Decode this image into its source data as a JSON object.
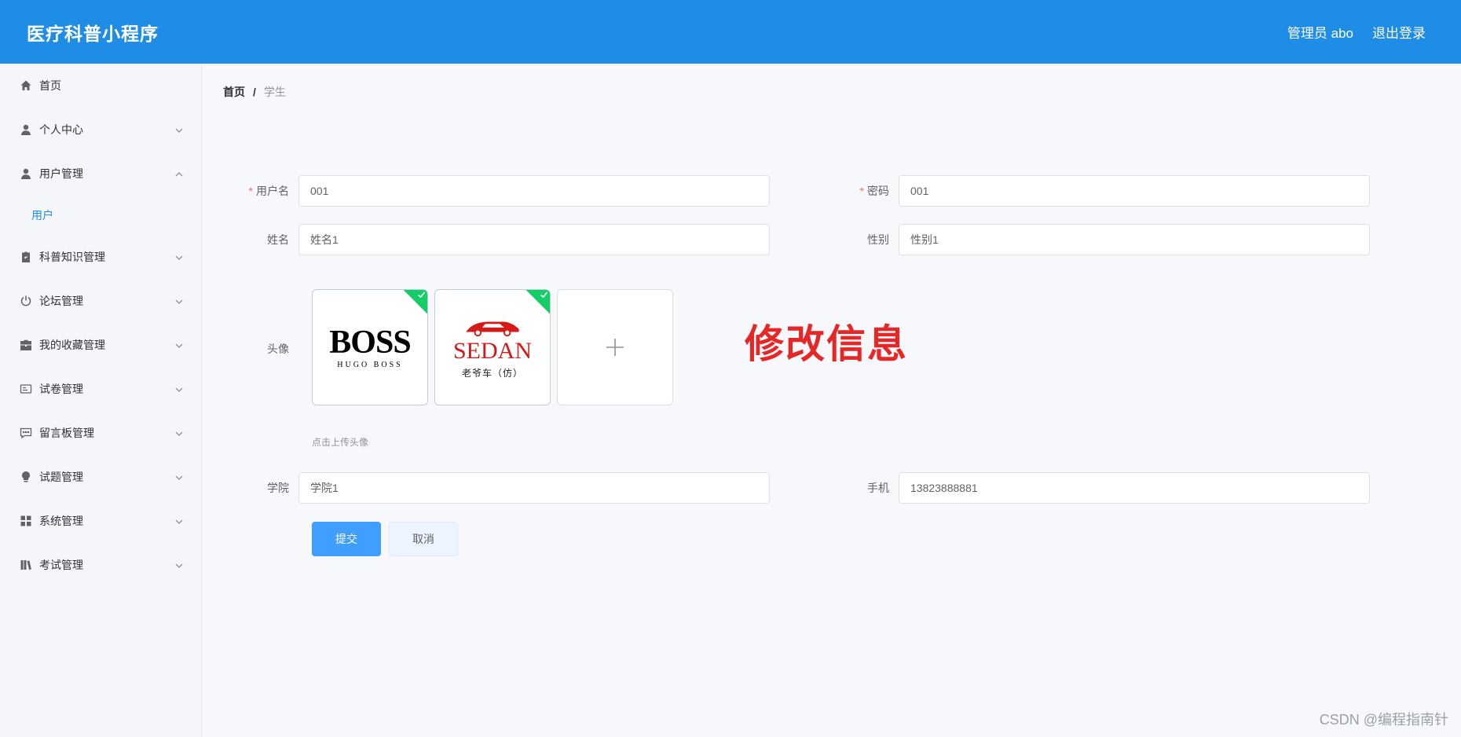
{
  "header": {
    "title": "医疗科普小程序",
    "user": "管理员 abo",
    "logout_label": "退出登录"
  },
  "sidebar": {
    "items": [
      {
        "label": "首页",
        "icon": "home-icon"
      },
      {
        "label": "个人中心",
        "icon": "user-icon"
      },
      {
        "label": "用户管理",
        "icon": "user-icon",
        "expanded": true,
        "children": [
          {
            "label": "用户"
          }
        ]
      },
      {
        "label": "科普知识管理",
        "icon": "clipboard-icon"
      },
      {
        "label": "论坛管理",
        "icon": "power-icon"
      },
      {
        "label": "我的收藏管理",
        "icon": "briefcase-icon"
      },
      {
        "label": "试卷管理",
        "icon": "id-card-icon"
      },
      {
        "label": "留言板管理",
        "icon": "chat-icon"
      },
      {
        "label": "试题管理",
        "icon": "bulb-icon"
      },
      {
        "label": "系统管理",
        "icon": "grid-icon"
      },
      {
        "label": "考试管理",
        "icon": "book-icon"
      }
    ]
  },
  "breadcrumb": {
    "home": "首页",
    "separator": "/",
    "current": "学生"
  },
  "form": {
    "username": {
      "label": "用户名",
      "value": "001"
    },
    "password": {
      "label": "密码",
      "value": "001"
    },
    "name": {
      "label": "姓名",
      "value": "姓名1"
    },
    "gender": {
      "label": "性别",
      "value": "性别1"
    },
    "avatar": {
      "label": "头像",
      "hint": "点击上传头像",
      "images": [
        {
          "title": "BOSS",
          "subtitle": "HUGO BOSS"
        },
        {
          "title": "SEDAN",
          "subtitle": "老爷车（仿）"
        }
      ]
    },
    "college": {
      "label": "学院",
      "value": "学院1"
    },
    "phone": {
      "label": "手机",
      "value": "13823888881"
    },
    "submit_label": "提交",
    "cancel_label": "取消",
    "required_mark": "*"
  },
  "overlay_text": "修改信息",
  "watermark": "CSDN @编程指南针",
  "colors": {
    "header": "#1f8ce6",
    "primary": "#409eff",
    "success_badge": "#13ce66",
    "overlay": "#e62727"
  }
}
